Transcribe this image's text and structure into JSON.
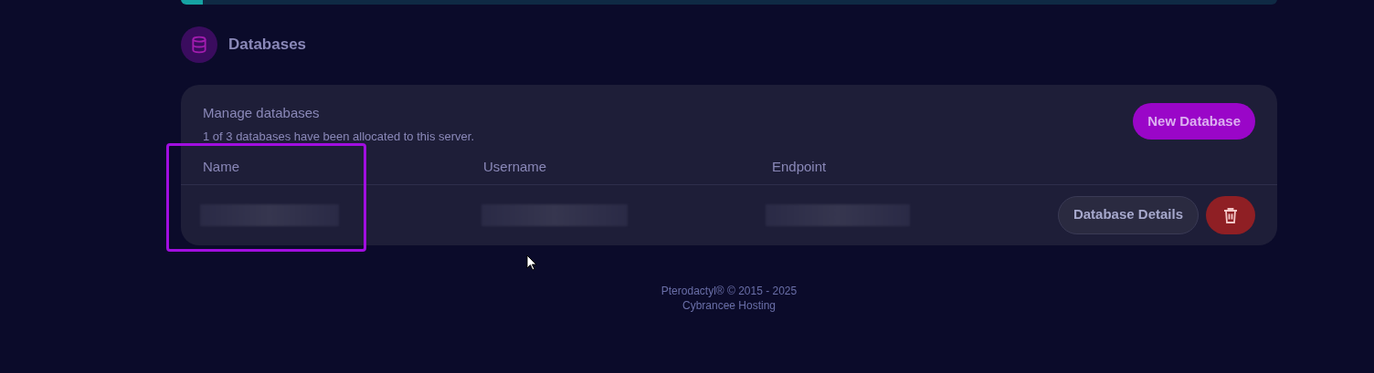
{
  "section": {
    "title": "Databases"
  },
  "card": {
    "title": "Manage databases",
    "subtitle": "1 of 3 databases have been allocated to this server.",
    "new_button": "New Database"
  },
  "table": {
    "columns": [
      "Name",
      "Username",
      "Endpoint"
    ],
    "rows": [
      {
        "details_button": "Database Details"
      }
    ]
  },
  "footer": [
    "Pterodactyl® © 2015 - 2025",
    "Cybrancee Hosting"
  ]
}
